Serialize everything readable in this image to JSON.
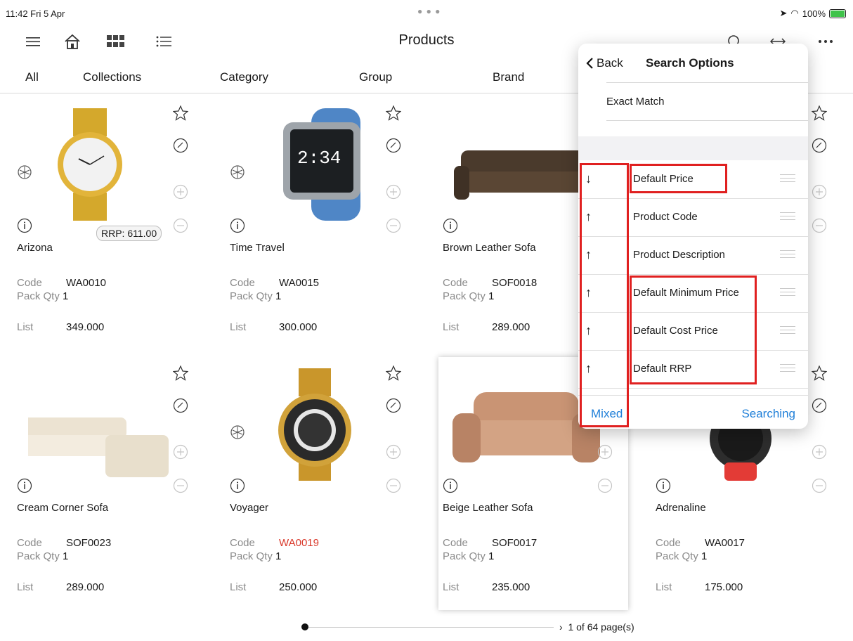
{
  "status": {
    "time": "11:42  Fri 5 Apr",
    "battery": "100%"
  },
  "header": {
    "title": "Products"
  },
  "tabs": [
    "All",
    "Collections",
    "Category",
    "Group",
    "Brand"
  ],
  "labels": {
    "code": "Code",
    "pack_qty": "Pack Qty",
    "list": "List"
  },
  "products": [
    {
      "name": "Arizona",
      "code": "WA0010",
      "pack_qty": "1",
      "list": "349.000",
      "rrp": "RRP: 611.00"
    },
    {
      "name": "Time Travel",
      "code": "WA0015",
      "pack_qty": "1",
      "list": "300.000"
    },
    {
      "name": "Brown Leather Sofa",
      "code": "SOF0018",
      "pack_qty": "1",
      "list": "289.000"
    },
    {
      "name": "Cream Corner Sofa",
      "code": "SOF0023",
      "pack_qty": "1",
      "list": "289.000"
    },
    {
      "name": "Voyager",
      "code": "WA0019",
      "pack_qty": "1",
      "list": "250.000",
      "code_color": "#d9392b"
    },
    {
      "name": "Beige Leather Sofa",
      "code": "SOF0017",
      "pack_qty": "1",
      "list": "235.000"
    },
    {
      "name": "Adrenaline",
      "code": "WA0017",
      "pack_qty": "1",
      "list": "175.000"
    }
  ],
  "pager": {
    "text": "1 of 64 page(s)"
  },
  "popover": {
    "back_label": "Back",
    "title": "Search Options",
    "exact_match": "Exact Match",
    "sort_rows": [
      {
        "label": "Default Price",
        "direction": "↓"
      },
      {
        "label": "Product Code",
        "direction": "↑"
      },
      {
        "label": "Product Description",
        "direction": "↑"
      },
      {
        "label": "Default Minimum Price",
        "direction": "↑"
      },
      {
        "label": "Default Cost Price",
        "direction": "↑"
      },
      {
        "label": "Default RRP",
        "direction": "↑"
      }
    ],
    "mixed_label": "Mixed",
    "searching_label": "Searching"
  },
  "colors": {
    "accent": "#1f7fd8",
    "highlight": "#e02020"
  }
}
